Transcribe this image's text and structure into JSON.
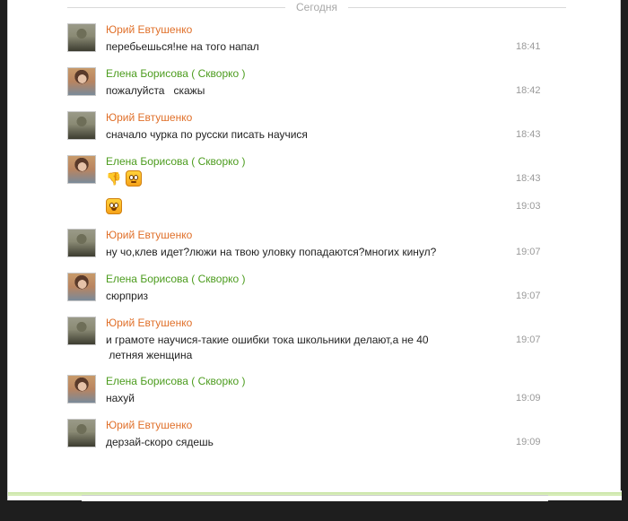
{
  "day_label": "Сегодня",
  "messages": [
    {
      "author": "Юрий Евтушенко",
      "text": "перебьешься!не на того напал",
      "time": "18:41"
    },
    {
      "author": "Елена Борисова ( Скворко )",
      "text": "пожалуйста   скажы",
      "time": "18:42"
    },
    {
      "author": "Юрий Евтушенко",
      "text": "сначало чурка по русски писать научися",
      "time": "18:43"
    },
    {
      "author": "Елена Борисова ( Скворко )",
      "emoji": [
        "thumbs-down-icon",
        "sad-face-emoji"
      ],
      "time": "18:43"
    },
    {
      "emoji": [
        "smile-face-emoji"
      ],
      "time": "19:03"
    },
    {
      "author": "Юрий Евтушенко",
      "text": "ну чо,клев идет?люжи на твою уловку попадаются?многих кинул?",
      "time": "19:07"
    },
    {
      "author": "Елена Борисова ( Скворко )",
      "text": "сюрприз",
      "time": "19:07"
    },
    {
      "author": "Юрий Евтушенко",
      "text": "и грамоте научися-такие ошибки тока школьники делают,а не 40\n летняя женщина",
      "time": "19:07"
    },
    {
      "author": "Елена Борисова ( Скворко )",
      "text": "нахуй",
      "time": "19:09"
    },
    {
      "author": "Юрий Евтушенко",
      "text": "дерзай-скоро сядешь",
      "time": "19:09"
    }
  ],
  "colors": {
    "male_author": "#e0702a",
    "female_author": "#4c9c1e",
    "text": "#222222",
    "time": "#9a9a9a",
    "background_outer": "#1e1e1e"
  }
}
